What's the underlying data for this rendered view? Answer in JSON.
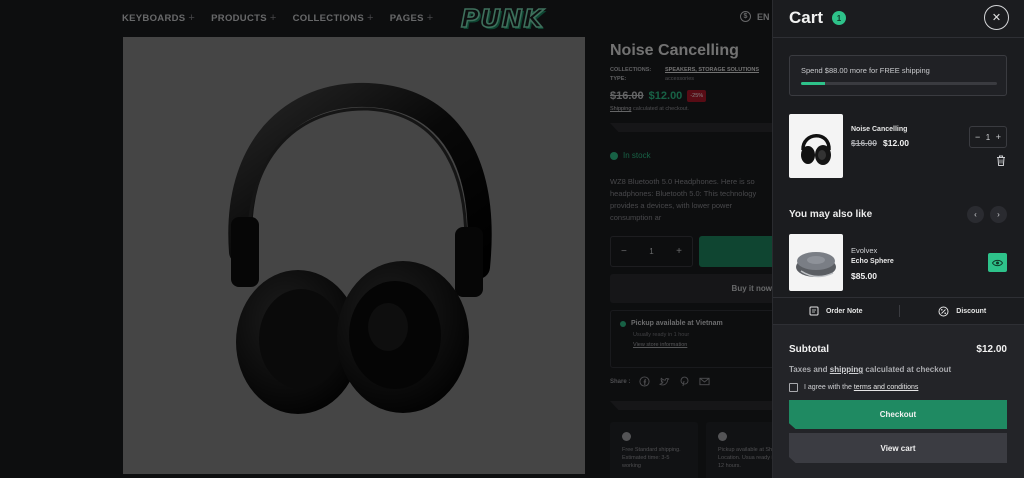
{
  "header": {
    "nav": [
      {
        "label": "KEYBOARDS"
      },
      {
        "label": "PRODUCTS"
      },
      {
        "label": "COLLECTIONS"
      },
      {
        "label": "PAGES"
      }
    ],
    "logo": "PUNK",
    "language": "EN"
  },
  "product": {
    "title": "Noise Cancelling",
    "collections_label": "COLLECTIONS:",
    "collections_value": "SPEAKERS, STORAGE SOLUTIONS",
    "type_label": "TYPE:",
    "type_value": "accessories",
    "old_price": "$16.00",
    "new_price": "$12.00",
    "discount": "-25%",
    "shipping_link": "Shipping",
    "shipping_text": " calculated at checkout.",
    "stock": "In stock",
    "description": "WZ8 Bluetooth 5.0 Headphones. Here is so headphones: Bluetooth 5.0: This technology provides a devices, with lower power consumption ar",
    "quantity": "1",
    "buy_now": "Buy it now",
    "pickup_title": "Pickup available at Vietnam",
    "pickup_ready": "Usually ready in 1 hour",
    "pickup_link": "View store information",
    "share_label": "Share :",
    "features": [
      {
        "text": "Free Standard shipping. Estimated time: 3-5 working"
      },
      {
        "text": "Pickup available at Shop Location. Usua ready in 12 hours."
      }
    ]
  },
  "cart": {
    "title": "Cart",
    "count": "1",
    "shipping_message": "Spend $88.00 more for FREE shipping",
    "shipping_progress": 0.12,
    "item": {
      "name": "Noise Cancelling",
      "old_price": "$16.00",
      "price": "$12.00",
      "quantity": "1"
    },
    "also_like_title": "You may also like",
    "recommendation": {
      "brand": "Evolvex",
      "name": "Echo Sphere",
      "price": "$85.00"
    },
    "order_note": "Order Note",
    "discount": "Discount",
    "subtotal_label": "Subtotal",
    "subtotal_value": "$12.00",
    "tax_pre": "Taxes and ",
    "tax_link": "shipping",
    "tax_post": " calculated at checkout",
    "agree_pre": "I agree with the ",
    "agree_link": "terms and conditions",
    "checkout": "Checkout",
    "view_cart": "View cart"
  },
  "colors": {
    "accent": "#2ec28a",
    "button_green": "#1f8a62",
    "sale_red": "#b0182b",
    "background": "#1b1c1f"
  }
}
